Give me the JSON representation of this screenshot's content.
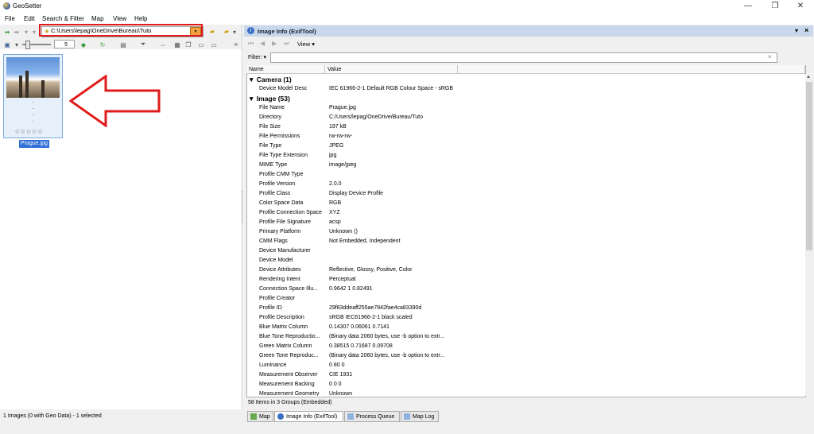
{
  "window": {
    "title": "GeoSetter",
    "min": "—",
    "restore": "❐",
    "close": "✕"
  },
  "menu": [
    "File",
    "Edit",
    "Search & Filter",
    "Map",
    "View",
    "Help"
  ],
  "left_toolbar": {
    "path_value": "C:\\Users\\lepag\\OneDrive\\Bureau\\Tuto",
    "spin_value": "5"
  },
  "thumbnail": {
    "filename": "Prague.jpg",
    "stars": "☆☆☆☆☆",
    "meta": [
      "-",
      "-",
      "-",
      "-"
    ]
  },
  "status_left": "1 Images (0 with Geo Data) - 1 selected",
  "panel": {
    "title": "Image Info (ExifTool)",
    "view_label": "View",
    "filter_label": "Filter:",
    "clear_label": "×",
    "columns": [
      "Name",
      "Value"
    ],
    "summary": "58 Items in 3 Groups   (Embedded)"
  },
  "groups": [
    {
      "title": "Camera (1)",
      "rows": [
        [
          "Device Model Desc",
          "IEC 61966-2-1 Default RGB Colour Space - sRGB"
        ]
      ]
    },
    {
      "title": "Image (53)",
      "rows": [
        [
          "File Name",
          "Prague.jpg"
        ],
        [
          "Directory",
          "C:/Users/lepag/OneDrive/Bureau/Tuto"
        ],
        [
          "File Size",
          "197 kB"
        ],
        [
          "File Permissions",
          "rw-rw-rw-"
        ],
        [
          "File Type",
          "JPEG"
        ],
        [
          "File Type Extension",
          "jpg"
        ],
        [
          "MIME Type",
          "image/jpeg"
        ],
        [
          "Profile CMM Type",
          ""
        ],
        [
          "Profile Version",
          "2.0.0"
        ],
        [
          "Profile Class",
          "Display Device Profile"
        ],
        [
          "Color Space Data",
          "RGB"
        ],
        [
          "Profile Connection Space",
          "XYZ"
        ],
        [
          "Profile File Signature",
          "acsp"
        ],
        [
          "Primary Platform",
          "Unknown ()"
        ],
        [
          "CMM Flags",
          "Not Embedded, Independent"
        ],
        [
          "Device Manufacturer",
          ""
        ],
        [
          "Device Model",
          ""
        ],
        [
          "Device Attributes",
          "Reflective, Glossy, Positive, Color"
        ],
        [
          "Rendering Intent",
          "Perceptual"
        ],
        [
          "Connection Space Illu...",
          "0.9642 1 0.82491"
        ],
        [
          "Profile Creator",
          ""
        ],
        [
          "Profile ID",
          "29f83ddeaff255ae7842fae4ca83390d"
        ],
        [
          "Profile Description",
          "sRGB IEC61966-2-1 black scaled"
        ],
        [
          "Blue Matrix Column",
          "0.14307 0.06061 0.7141"
        ],
        [
          "Blue Tone Reproductio...",
          "(Binary data 2060 bytes, use -b option to extr..."
        ],
        [
          "Green Matrix Column",
          "0.38515 0.71687 0.09708"
        ],
        [
          "Green Tone Reproduc...",
          "(Binary data 2060 bytes, use -b option to extr..."
        ],
        [
          "Luminance",
          "0 80 0"
        ],
        [
          "Measurement Observer",
          "CIE 1931"
        ],
        [
          "Measurement Backing",
          "0 0 0"
        ],
        [
          "Measurement Geometry",
          "Unknown"
        ]
      ]
    }
  ],
  "tabs": [
    {
      "label": "Map",
      "active": false
    },
    {
      "label": "Image Info (ExifTool)",
      "active": true
    },
    {
      "label": "Process Queue",
      "active": false
    },
    {
      "label": "Map Log",
      "active": false
    }
  ],
  "colors": {
    "highlight": "#e01b1b",
    "selection": "#2f6fd6",
    "panel_header": "#c9d7ea"
  }
}
